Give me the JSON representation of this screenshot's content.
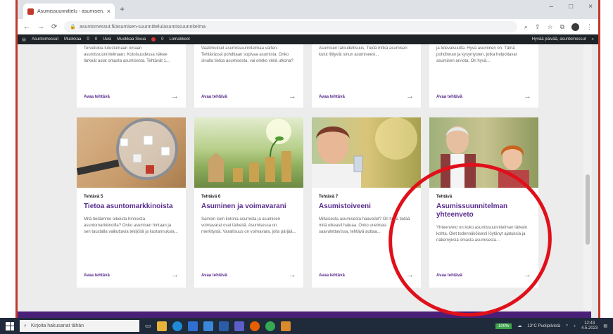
{
  "browser": {
    "tab_title": "Asumissuunnittelu - asumisen...",
    "tab_close": "×",
    "new_tab": "+",
    "url": "asuntomessut.fi/asumisen-suunnittelu/asumissuunnitelma",
    "window_controls": [
      "–",
      "□",
      "×"
    ]
  },
  "adminbar": {
    "items": [
      "Asuntomessut",
      "Muokkaa",
      "0",
      "0",
      "Uusi",
      "Muokkaa Sivua",
      "0",
      "Lomakkeet"
    ],
    "right_label": "Hyvää päivää, asuntomessut"
  },
  "top_cards": [
    {
      "text": "Tervetuloa tutustumaan omaan asumissuunnitelmaan. Kotoisuudessa näkee tärkeät asiat omasta asumisesta. Tehtävät 1...",
      "link": "Avaa tehtävä",
      "arrow": "→"
    },
    {
      "text": "Vaatimukset asumissuunnitelmaa varten. Tehtävässä pohditaan sopivaa asumista. Onko sinulla tietoa asumisesta, vai oletko vielä ulkona?",
      "link": "Avaa tehtävä",
      "arrow": "→"
    },
    {
      "text": "Asumisen taloudellisuus. Tiedä mitkä asumisen kulut liittyvät sinun asumiseesi...",
      "link": "Avaa tehtävä",
      "arrow": "→"
    },
    {
      "text": "ja tulevaisuutta. Hyvä asuminen on. Tämä pohdinnan ja kysymysten, jotka helpottavat asumisen arviota. On hyvä...",
      "link": "Avaa tehtävä",
      "arrow": "→"
    }
  ],
  "cards": [
    {
      "tag": "Tehtävä 5",
      "title": "Tietoa asuntomarkkinoista",
      "body": "Mitä tiedämme oikeista hinnoista asuntomarkkinoilla? Onko asumisen hintaan ja sen taustalla vaikuttavia tekijöitä ja kustannuksia...",
      "link": "Avaa tehtävä",
      "arrow": "→"
    },
    {
      "tag": "Tehtävä 6",
      "title": "Asuminen ja voimavarani",
      "body": "Samoin kuin kotona asumista ja asumisen voimavarat ovat tärkeitä. Asumisessa on merkitystä. Varallisuus on voimavara, jolla pärjää...",
      "link": "Avaa tehtävä",
      "arrow": "→"
    },
    {
      "tag": "Tehtävä 7",
      "title": "Asumistoiveeni",
      "body": "Millaisesta asumisesta haaveilet? On hyvä tietää mitä oikeasti haluaa. Onko unelmasi saavutettavissa, tehtävä auttaa...",
      "link": "Avaa tehtävä",
      "arrow": "→"
    },
    {
      "tag": "Tehtävä",
      "title": "Asumissuunnitelman yhteenveto",
      "body": "Yhteenveto on koko asumissuunnitelman tärkein kohta. Olet todennäköisesti löytänyt ajatuksia ja näkemyksiä omasta asumisesta...",
      "link": "Avaa tehtävä",
      "arrow": "→"
    }
  ],
  "taskbar": {
    "search_placeholder": "Kirjoita hakusanat tähän",
    "battery": "100%",
    "weather": "13°C Puolipilvistä",
    "time": "12:43",
    "date": "4.5.2023"
  },
  "colors": {
    "accent_purple": "#5b2d8e",
    "annotation_red": "#e0101a",
    "admin_bar": "#1d2327"
  }
}
